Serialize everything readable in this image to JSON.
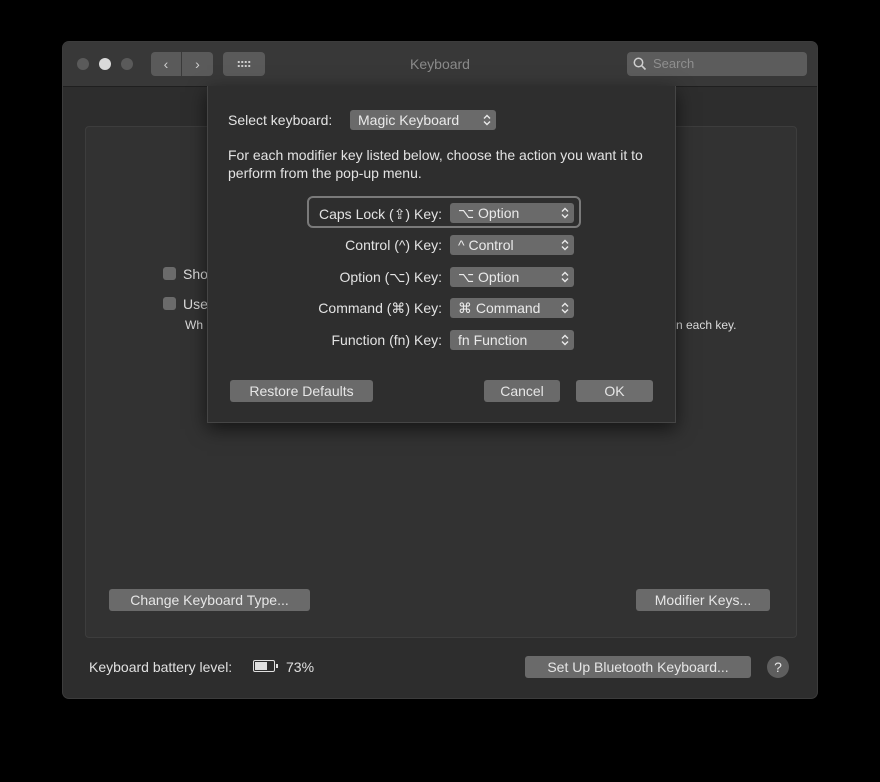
{
  "window": {
    "title": "Keyboard",
    "search_placeholder": "Search"
  },
  "background": {
    "checkbox1_label": "Sho",
    "checkbox2_label": "Use",
    "description_left": "Wh",
    "description_right": "n each key.",
    "change_keyboard_type": "Change Keyboard Type...",
    "modifier_keys": "Modifier Keys...",
    "battery_label": "Keyboard battery level:",
    "battery_value": "73%",
    "battery_fraction": 0.73,
    "setup_bluetooth": "Set Up Bluetooth Keyboard...",
    "help": "?"
  },
  "sheet": {
    "select_keyboard_label": "Select keyboard:",
    "select_keyboard_value": "Magic Keyboard",
    "instructions": "For each modifier key listed below, choose the action you want it to perform from the pop-up menu.",
    "rows": [
      {
        "label": "Caps Lock (⇪) Key:",
        "value": "⌥ Option"
      },
      {
        "label": "Control (^) Key:",
        "value": "^ Control"
      },
      {
        "label": "Option (⌥) Key:",
        "value": "⌥ Option"
      },
      {
        "label": "Command (⌘) Key:",
        "value": "⌘ Command"
      },
      {
        "label": "Function (fn) Key:",
        "value": "fn Function"
      }
    ],
    "restore_defaults": "Restore Defaults",
    "cancel": "Cancel",
    "ok": "OK"
  }
}
